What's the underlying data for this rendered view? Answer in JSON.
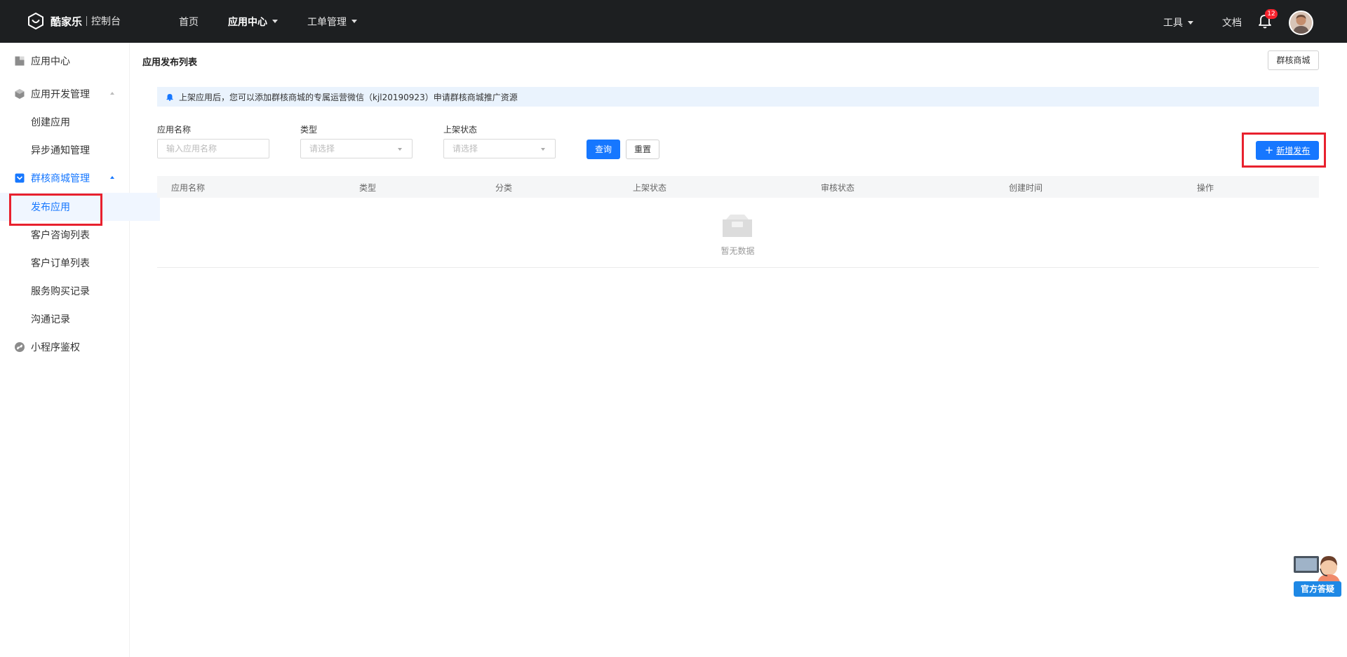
{
  "header": {
    "brand": "酷家乐",
    "console": "控制台",
    "nav": [
      {
        "label": "首页"
      },
      {
        "label": "应用中心"
      },
      {
        "label": "工单管理"
      }
    ],
    "tools_label": "工具",
    "docs_label": "文档",
    "notification_count": "12"
  },
  "sidebar": {
    "items": [
      {
        "label": "应用中心"
      },
      {
        "label": "应用开发管理"
      },
      {
        "label": "创建应用"
      },
      {
        "label": "异步通知管理"
      },
      {
        "label": "群核商城管理"
      },
      {
        "label": "发布应用"
      },
      {
        "label": "客户咨询列表"
      },
      {
        "label": "客户订单列表"
      },
      {
        "label": "服务购买记录"
      },
      {
        "label": "沟通记录"
      },
      {
        "label": "小程序鉴权"
      }
    ]
  },
  "main": {
    "title": "应用发布列表",
    "mall_button": "群核商城",
    "notice": "上架应用后，您可以添加群核商城的专属运营微信（kjl20190923）申请群核商城推广资源",
    "filters": {
      "name_label": "应用名称",
      "name_placeholder": "输入应用名称",
      "type_label": "类型",
      "type_placeholder": "请选择",
      "status_label": "上架状态",
      "status_placeholder": "请选择"
    },
    "query_button": "查询",
    "reset_button": "重置",
    "new_button": "新增发布",
    "table": {
      "columns": [
        "应用名称",
        "类型",
        "分类",
        "上架状态",
        "审核状态",
        "创建时间",
        "操作"
      ],
      "empty_text": "暂无数据"
    },
    "help_widget": "官方答疑"
  },
  "colors": {
    "primary": "#1677ff",
    "header_bg": "#1d1f21",
    "notice_bg": "#eaf3fd",
    "highlight": "#e8212e"
  }
}
